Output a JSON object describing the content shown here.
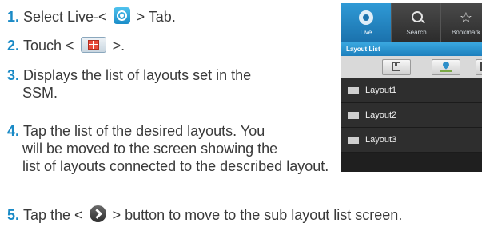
{
  "steps": [
    {
      "num": "1.",
      "pre": "Select Live-<",
      "post": "> Tab."
    },
    {
      "num": "2.",
      "pre": "Touch <",
      "post": ">."
    },
    {
      "num": "3.",
      "line1": "Displays the list of layouts set in the",
      "line2": "SSM."
    },
    {
      "num": "4.",
      "line1": "Tap the list of the desired layouts. You",
      "line2": "will be moved to the screen showing the",
      "line3": "list of layouts connected to the described layout."
    },
    {
      "num": "5.",
      "pre": "Tap the <",
      "post": "> button to move to the sub layout list screen."
    }
  ],
  "phone": {
    "tabs": {
      "live": "Live",
      "search": "Search",
      "bookmark": "Bookmark"
    },
    "header": "Layout List",
    "layouts": [
      "Layout1",
      "Layout2",
      "Layout3"
    ]
  },
  "colors": {
    "accent": "#1a8ac6",
    "live_tab": "#1b72ad"
  }
}
